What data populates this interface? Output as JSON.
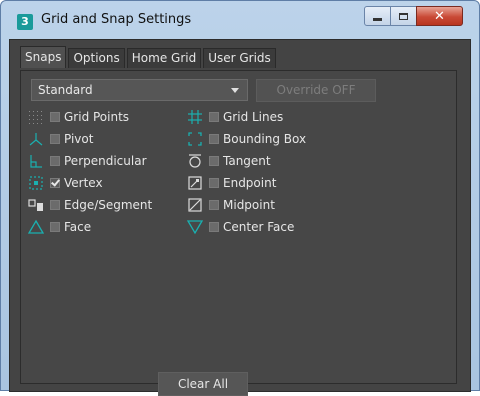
{
  "window": {
    "app_icon": "3",
    "title": "Grid and Snap Settings",
    "controls": {
      "minimize": "minimize-icon",
      "maximize": "maximize-icon",
      "close": "close-icon"
    }
  },
  "tabs": [
    {
      "label": "Snaps",
      "active": true
    },
    {
      "label": "Options",
      "active": false
    },
    {
      "label": "Home Grid",
      "active": false
    },
    {
      "label": "User Grids",
      "active": false
    }
  ],
  "snaps": {
    "dropdown_value": "Standard",
    "override_label": "Override OFF",
    "clear_all_label": "Clear All",
    "left_column": [
      {
        "label": "Grid Points",
        "icon": "grid-points-icon",
        "checked": false
      },
      {
        "label": "Pivot",
        "icon": "pivot-icon",
        "checked": false
      },
      {
        "label": "Perpendicular",
        "icon": "perpendicular-icon",
        "checked": false
      },
      {
        "label": "Vertex",
        "icon": "vertex-icon",
        "checked": true
      },
      {
        "label": "Edge/Segment",
        "icon": "edge-segment-icon",
        "checked": false
      },
      {
        "label": "Face",
        "icon": "face-icon",
        "checked": false
      }
    ],
    "right_column": [
      {
        "label": "Grid Lines",
        "icon": "grid-lines-icon",
        "checked": false
      },
      {
        "label": "Bounding Box",
        "icon": "bounding-box-icon",
        "checked": false
      },
      {
        "label": "Tangent",
        "icon": "tangent-icon",
        "checked": false
      },
      {
        "label": "Endpoint",
        "icon": "endpoint-icon",
        "checked": false
      },
      {
        "label": "Midpoint",
        "icon": "midpoint-icon",
        "checked": false
      },
      {
        "label": "Center Face",
        "icon": "center-face-icon",
        "checked": false
      }
    ]
  },
  "colors": {
    "icon_teal": "#1ab0b0",
    "icon_white": "#dcdcdc",
    "panel_bg": "#474747",
    "titlebar_bg": "#b4cce6"
  }
}
